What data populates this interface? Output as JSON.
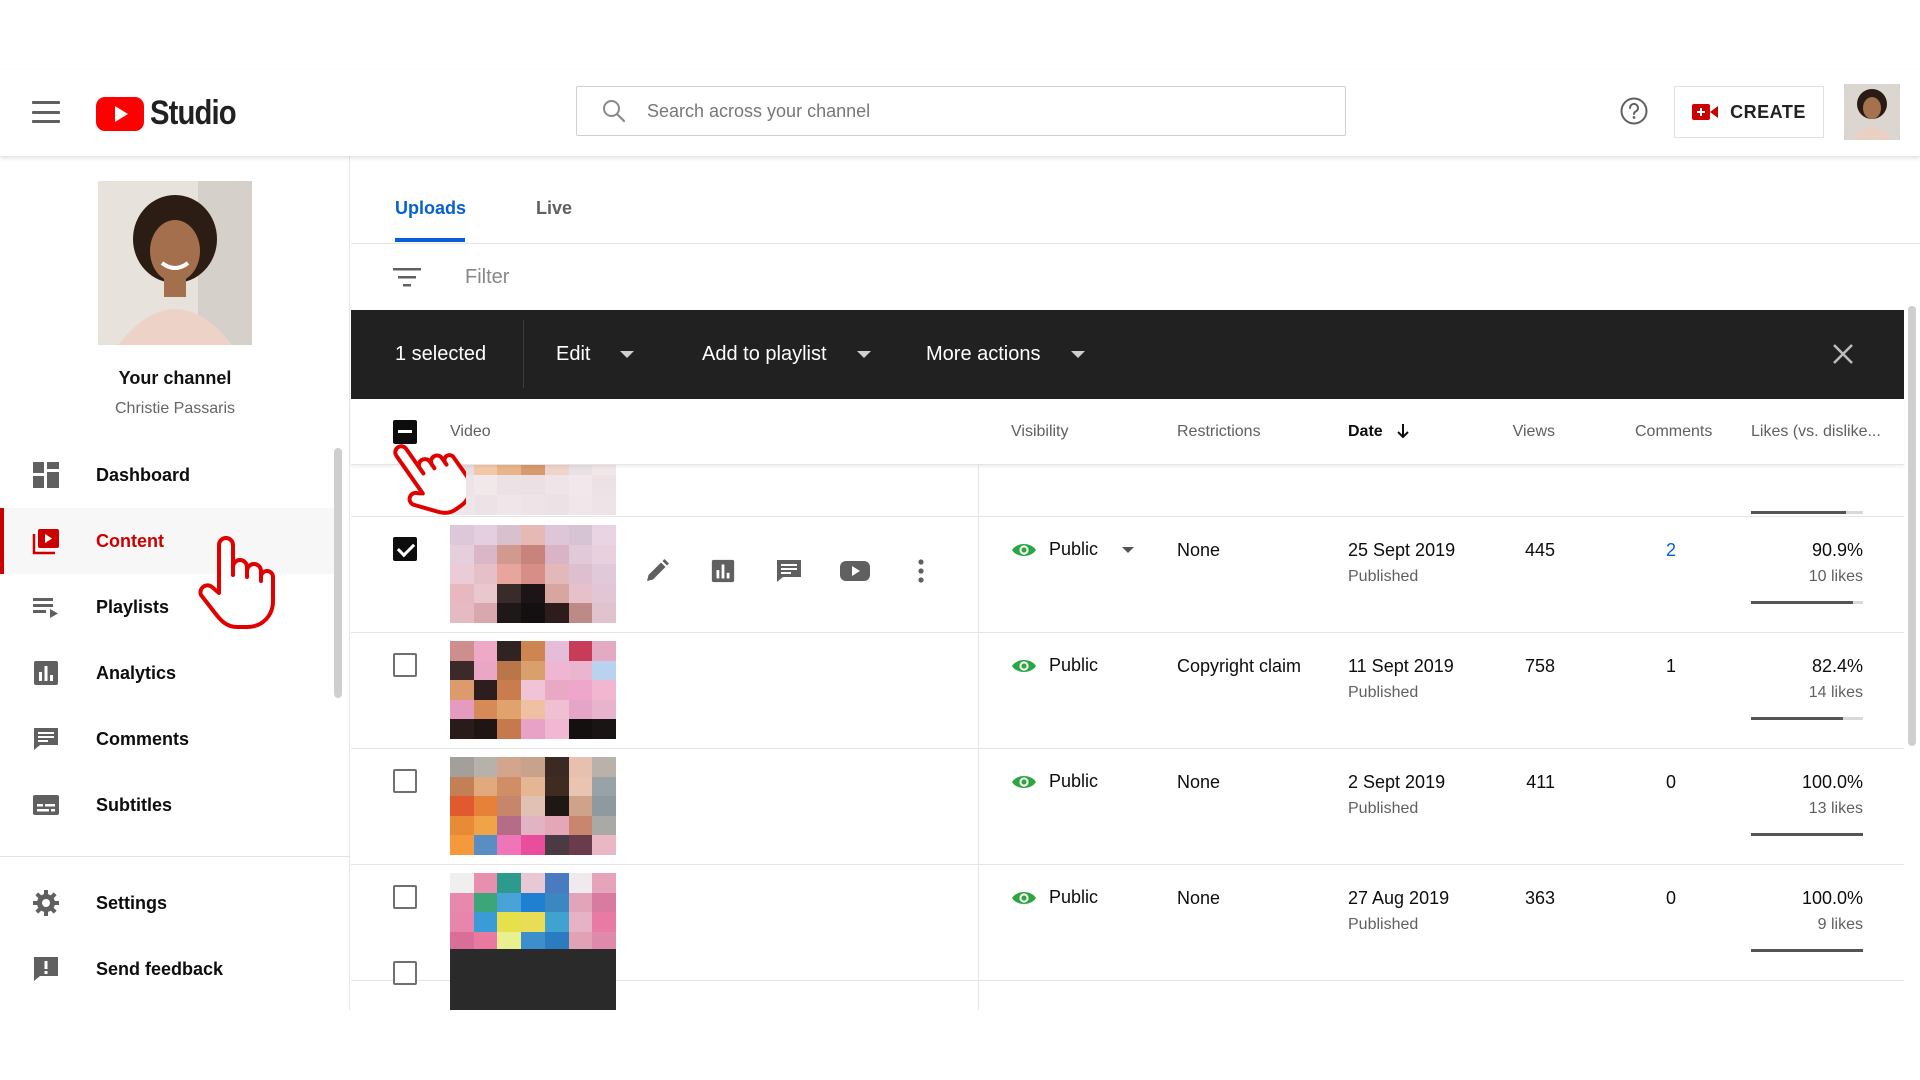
{
  "header": {
    "logo_text": "Studio",
    "search_placeholder": "Search across your channel",
    "create_label": "CREATE"
  },
  "sidebar": {
    "channel_title": "Your channel",
    "channel_name": "Christie Passaris",
    "items": [
      {
        "label": "Dashboard",
        "icon": "dashboard-icon"
      },
      {
        "label": "Content",
        "icon": "content-icon",
        "active": true
      },
      {
        "label": "Playlists",
        "icon": "playlists-icon"
      },
      {
        "label": "Analytics",
        "icon": "analytics-icon"
      },
      {
        "label": "Comments",
        "icon": "comments-icon"
      },
      {
        "label": "Subtitles",
        "icon": "subtitles-icon"
      }
    ],
    "bottom_items": [
      {
        "label": "Settings",
        "icon": "gear-icon"
      },
      {
        "label": "Send feedback",
        "icon": "feedback-icon"
      }
    ]
  },
  "tabs": [
    {
      "label": "Uploads",
      "active": true
    },
    {
      "label": "Live"
    }
  ],
  "filter": {
    "placeholder": "Filter"
  },
  "action_bar": {
    "selected_label": "1 selected",
    "edit_label": "Edit",
    "add_to_playlist_label": "Add to playlist",
    "more_actions_label": "More actions"
  },
  "table": {
    "columns": {
      "video": "Video",
      "visibility": "Visibility",
      "restrictions": "Restrictions",
      "date": "Date",
      "views": "Views",
      "comments": "Comments",
      "likes": "Likes (vs. dislike..."
    },
    "rows": [
      {
        "checked": true,
        "visibility": "Public",
        "restrictions": "None",
        "date": "25 Sept 2019",
        "status": "Published",
        "views": "445",
        "comments": "2",
        "likes_pct": "90.9%",
        "likes_count": "10 likes",
        "like_ratio": 0.909
      },
      {
        "checked": false,
        "visibility": "Public",
        "restrictions": "Copyright claim",
        "date": "11 Sept 2019",
        "status": "Published",
        "views": "758",
        "comments": "1",
        "likes_pct": "82.4%",
        "likes_count": "14 likes",
        "like_ratio": 0.824
      },
      {
        "checked": false,
        "visibility": "Public",
        "restrictions": "None",
        "date": "2 Sept 2019",
        "status": "Published",
        "views": "411",
        "comments": "0",
        "likes_pct": "100.0%",
        "likes_count": "13 likes",
        "like_ratio": 1.0
      },
      {
        "checked": false,
        "visibility": "Public",
        "restrictions": "None",
        "date": "27 Aug 2019",
        "status": "Published",
        "views": "363",
        "comments": "0",
        "likes_pct": "100.0%",
        "likes_count": "9 likes",
        "like_ratio": 1.0
      }
    ],
    "partial_top_row": {
      "like_ratio": 0.85
    }
  },
  "colors": {
    "brand_red": "#ff0000",
    "accent_blue": "#065fd4",
    "public_green": "#2ba640",
    "action_bar_bg": "#212121"
  },
  "thumbnails": [
    [
      "#e8c9b0",
      "#f0b98a",
      "#efc19a",
      "#e2a877",
      "#3a2a22",
      "#2b1d18",
      "#d9cfd0",
      "#f4d2b6",
      "#f1b27d",
      "#e59f6a",
      "#c8875a",
      "#2a2222",
      "#1b1416",
      "#efe7e5",
      "#e9dde0",
      "#f3c8a7",
      "#eab48a",
      "#d79a6f",
      "#efd4c9",
      "#e9e1e4",
      "#f1e7e9",
      "#eee4e8",
      "#f1e8ea",
      "#ece2e6",
      "#ebe0e4",
      "#efe5e8",
      "#f2e8eb",
      "#ece2e6",
      "#efe6e9",
      "#ede3e7",
      "#f0e6e9",
      "#eee4e8",
      "#ece2e5",
      "#f1e7ea",
      "#eee4e7"
    ],
    [
      "#dcc8d8",
      "#e3cfe0",
      "#d8c0cf",
      "#e7b9b4",
      "#dcc6d8",
      "#d6c3d4",
      "#e9d4e3",
      "#e6cfdc",
      "#d9b7c7",
      "#d29a8f",
      "#c8837c",
      "#d8b4c6",
      "#e1c9da",
      "#e8d0df",
      "#eacbd6",
      "#e5c0c9",
      "#e8a59e",
      "#d68e86",
      "#e3b8b8",
      "#dcc0cf",
      "#e0c9d9",
      "#e7b8c0",
      "#eac7cf",
      "#3a2b2b",
      "#1c1416",
      "#d8a6a0",
      "#e7c1c9",
      "#e2c6d5",
      "#e5bac3",
      "#d9a7ae",
      "#1e1818",
      "#140f10",
      "#2e1c1c",
      "#bd8a86",
      "#e1c2cf"
    ],
    [
      "#cf8e8e",
      "#efa9c7",
      "#2f2323",
      "#cf8552",
      "#e6bdd8",
      "#c83c5a",
      "#e3aac1",
      "#3c2a2a",
      "#e9a6c5",
      "#b97649",
      "#d8a06c",
      "#efb6d4",
      "#eab6cf",
      "#b9d2f0",
      "#dd9b6d",
      "#2c1e1e",
      "#c97d4c",
      "#f1c3d6",
      "#e9a8c4",
      "#eea7cb",
      "#f1b7d1",
      "#e59ac0",
      "#d68a58",
      "#e1a36e",
      "#efc0a1",
      "#f0bfd2",
      "#e6a5c6",
      "#e8b3cc",
      "#2a1b1b",
      "#1f1515",
      "#c47a4d",
      "#e8a2c5",
      "#f2b7d2",
      "#151010",
      "#1b1414"
    ],
    [
      "#a3a09b",
      "#b6b1ab",
      "#d3a58c",
      "#c9a28b",
      "#3b2a24",
      "#e8c0b0",
      "#b8b2ab",
      "#c38056",
      "#e0aa7c",
      "#cf8e66",
      "#e5b694",
      "#3f2b22",
      "#e9c4b0",
      "#98a3a8",
      "#e15a2f",
      "#e7813a",
      "#c7866c",
      "#e0c1b3",
      "#1f1713",
      "#cfa28c",
      "#8f9aa0",
      "#e98a36",
      "#f1a447",
      "#b46d86",
      "#e2b3c3",
      "#e4a7b8",
      "#c8866e",
      "#a9a9a6",
      "#f59a3c",
      "#5a8dc4",
      "#f074b8",
      "#e94d9c",
      "#4a3a44",
      "#6a3b4a",
      "#e9b8c4"
    ],
    [
      "#f1eef0",
      "#e88fb0",
      "#2c9a8d",
      "#e9c8d6",
      "#4a7bc1",
      "#f0eaee",
      "#e6a4bb",
      "#e888ad",
      "#3ca57a",
      "#49a3d8",
      "#1f7fd1",
      "#3b87c0",
      "#e1a4b9",
      "#d97aa1",
      "#e885ab",
      "#3a9cd6",
      "#e6e04a",
      "#e9dd55",
      "#3fa2cf",
      "#e6b3c6",
      "#e87aa3",
      "#d96e98",
      "#e9799f",
      "#e8f090",
      "#3c8fcc",
      "#2a7bc0",
      "#e2a2b5",
      "#e08aab",
      "#e680a6",
      "#e6a0b5",
      "#ec7ca3",
      "#e18db0",
      "#e788ab",
      "#e7a8bd",
      "#de7ba0"
    ]
  ]
}
